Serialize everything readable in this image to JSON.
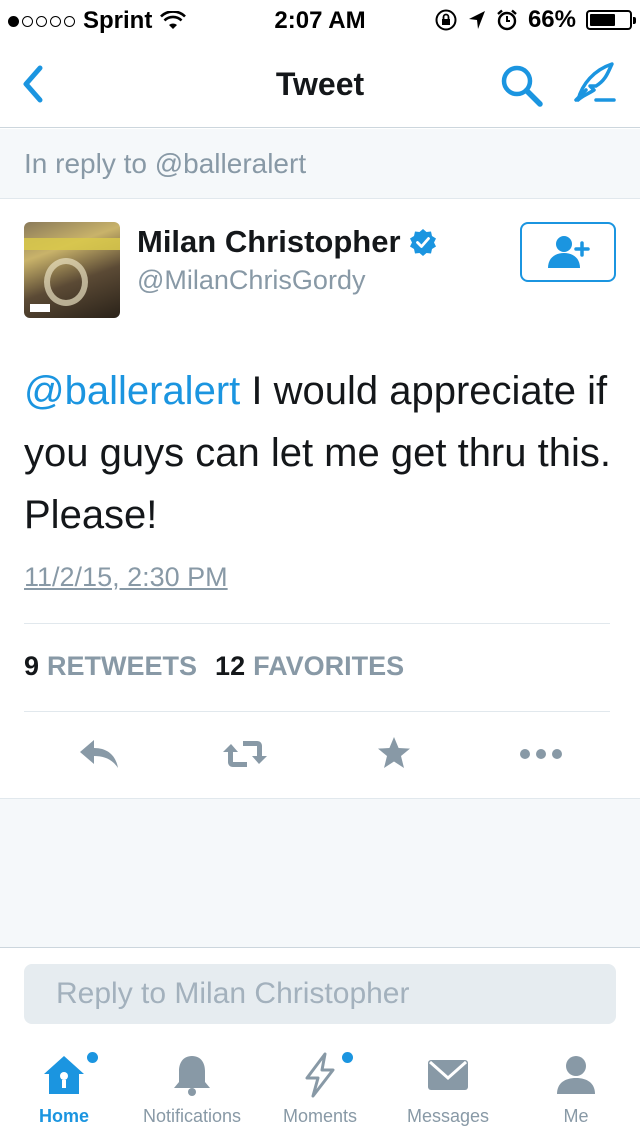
{
  "status_bar": {
    "carrier": "Sprint",
    "time": "2:07 AM",
    "battery": "66%",
    "battery_level": 0.66
  },
  "nav": {
    "title": "Tweet"
  },
  "reply_banner": "In reply to @balleralert",
  "tweet": {
    "author_name": "Milan Christopher",
    "author_handle": "@MilanChrisGordy",
    "mention": "@balleralert",
    "text": " I would appreciate if you guys can let me get thru this. Please!",
    "timestamp": "11/2/15, 2:30 PM",
    "retweets_count": "9",
    "retweets_label": "RETWEETS",
    "favorites_count": "12",
    "favorites_label": "FAVORITES"
  },
  "reply": {
    "placeholder": "Reply to Milan Christopher"
  },
  "tabs": [
    {
      "label": "Home"
    },
    {
      "label": "Notifications"
    },
    {
      "label": "Moments"
    },
    {
      "label": "Messages"
    },
    {
      "label": "Me"
    }
  ],
  "colors": {
    "accent": "#1b95e0",
    "muted": "#8899a6",
    "text": "#14171a"
  }
}
